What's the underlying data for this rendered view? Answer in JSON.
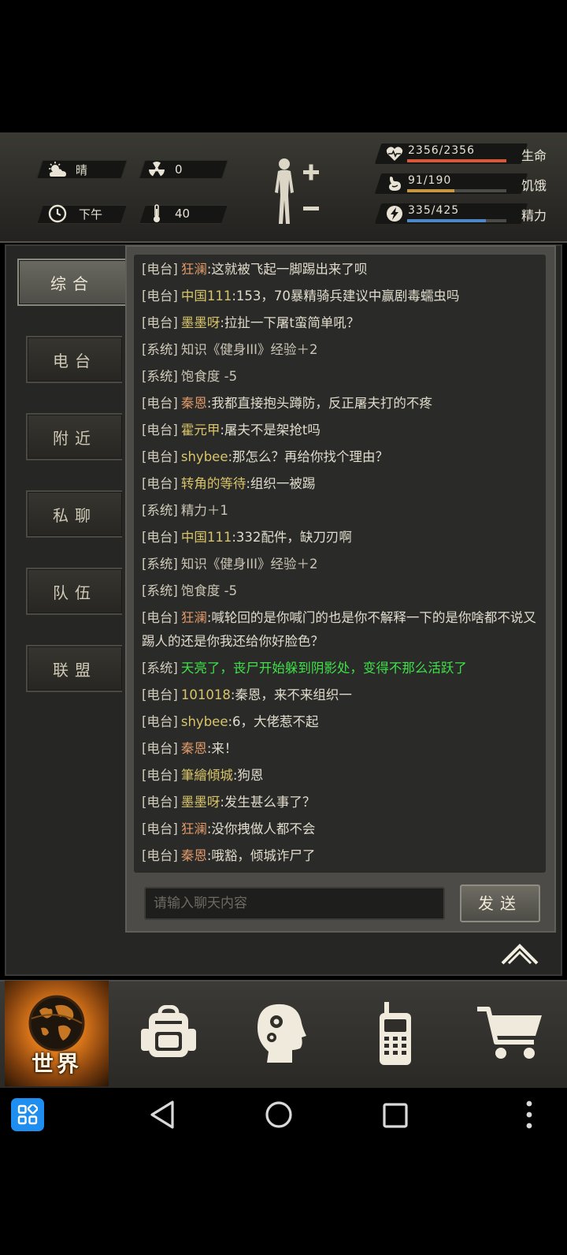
{
  "status": {
    "weather": {
      "icon": "weather-cloud-sun-icon",
      "label": "晴"
    },
    "radiation": {
      "icon": "radiation-icon",
      "value": "0"
    },
    "time": {
      "icon": "clock-icon",
      "label": "下午"
    },
    "temperature": {
      "icon": "thermometer-icon",
      "value": "40"
    },
    "stats": [
      {
        "name": "health",
        "label": "生命",
        "value": "2356/2356",
        "fraction": 1.0,
        "color": "#d9583a",
        "icon": "heart-pulse-icon"
      },
      {
        "name": "hunger",
        "label": "饥饿",
        "value": "91/190",
        "fraction": 0.48,
        "color": "#c79642",
        "icon": "stomach-icon"
      },
      {
        "name": "energy",
        "label": "精力",
        "value": "335/425",
        "fraction": 0.79,
        "color": "#4f86c6",
        "icon": "energy-bolt-icon"
      }
    ]
  },
  "tabs": [
    "综合",
    "电台",
    "附近",
    "私聊",
    "队伍",
    "联盟"
  ],
  "active_tab": "综合",
  "messages": [
    {
      "channel": "[电台]",
      "name": "狂澜",
      "name_color": "orange",
      "text": ":这就被飞起一脚踢出来了呗"
    },
    {
      "channel": "[电台]",
      "name": "中国111",
      "name_color": "yellow",
      "text": ":153，70暴精骑兵建议中赢剧毒蠕虫吗"
    },
    {
      "channel": "[电台]",
      "name": "墨墨呀",
      "name_color": "yellow",
      "text": ":拉扯一下屠t蛮简单吼？"
    },
    {
      "channel": "[系统]",
      "name": "",
      "name_color": "",
      "text": "知识《健身III》经验＋2"
    },
    {
      "channel": "[系统]",
      "name": "",
      "name_color": "",
      "text": "饱食度 -5"
    },
    {
      "channel": "[电台]",
      "name": "秦恩",
      "name_color": "orange",
      "text": ":我都直接抱头蹲防，反正屠夫打的不疼"
    },
    {
      "channel": "[电台]",
      "name": "霍元甲",
      "name_color": "yellow",
      "text": ":屠夫不是架抢t吗"
    },
    {
      "channel": "[电台]",
      "name": "shybee",
      "name_color": "yellow",
      "text": ":那怎么？再给你找个理由？"
    },
    {
      "channel": "[电台]",
      "name": "转角的等待",
      "name_color": "yellow",
      "text": ":组织一被踢"
    },
    {
      "channel": "[系统]",
      "name": "",
      "name_color": "",
      "text": "精力＋1"
    },
    {
      "channel": "[电台]",
      "name": "中国111",
      "name_color": "yellow",
      "text": ":332配件，缺刀刃啊"
    },
    {
      "channel": "[系统]",
      "name": "",
      "name_color": "",
      "text": "知识《健身III》经验＋2"
    },
    {
      "channel": "[系统]",
      "name": "",
      "name_color": "",
      "text": "饱食度 -5"
    },
    {
      "channel": "[电台]",
      "name": "狂澜",
      "name_color": "orange",
      "text": ":喊轮回的是你喊门的也是你不解释一下的是你啥都不说又踢人的还是你我还给你好脸色？",
      "wrap": true
    },
    {
      "channel": "[系统]",
      "name": "",
      "name_color": "",
      "text": "天亮了，丧尸开始躲到阴影处，变得不那么活跃了",
      "green": true
    },
    {
      "channel": "[电台]",
      "name": "101018",
      "name_color": "yellow",
      "text": ":秦恩，来不来组织一"
    },
    {
      "channel": "[电台]",
      "name": "shybee",
      "name_color": "yellow",
      "text": ":6，大佬惹不起"
    },
    {
      "channel": "[电台]",
      "name": "秦恩",
      "name_color": "orange",
      "text": ":来！"
    },
    {
      "channel": "[电台]",
      "name": "筆繪傾城",
      "name_color": "yellow",
      "text": ":狗恩"
    },
    {
      "channel": "[电台]",
      "name": "墨墨呀",
      "name_color": "yellow",
      "text": ":发生甚么事了？"
    },
    {
      "channel": "[电台]",
      "name": "狂澜",
      "name_color": "orange",
      "text": ":没你拽做人都不会"
    },
    {
      "channel": "[电台]",
      "name": "秦恩",
      "name_color": "orange",
      "text": ":哦豁，倾城诈尸了"
    }
  ],
  "input": {
    "placeholder": "请输入聊天内容"
  },
  "send_label": "发送",
  "bottom_nav": {
    "world_label": "世界",
    "items": [
      "world-globe-icon",
      "backpack-icon",
      "brain-skills-icon",
      "walkie-talkie-icon",
      "shopping-cart-icon"
    ]
  },
  "android_nav": [
    "app-grid-icon",
    "back-icon",
    "home-icon",
    "recents-icon",
    "more-icon"
  ]
}
